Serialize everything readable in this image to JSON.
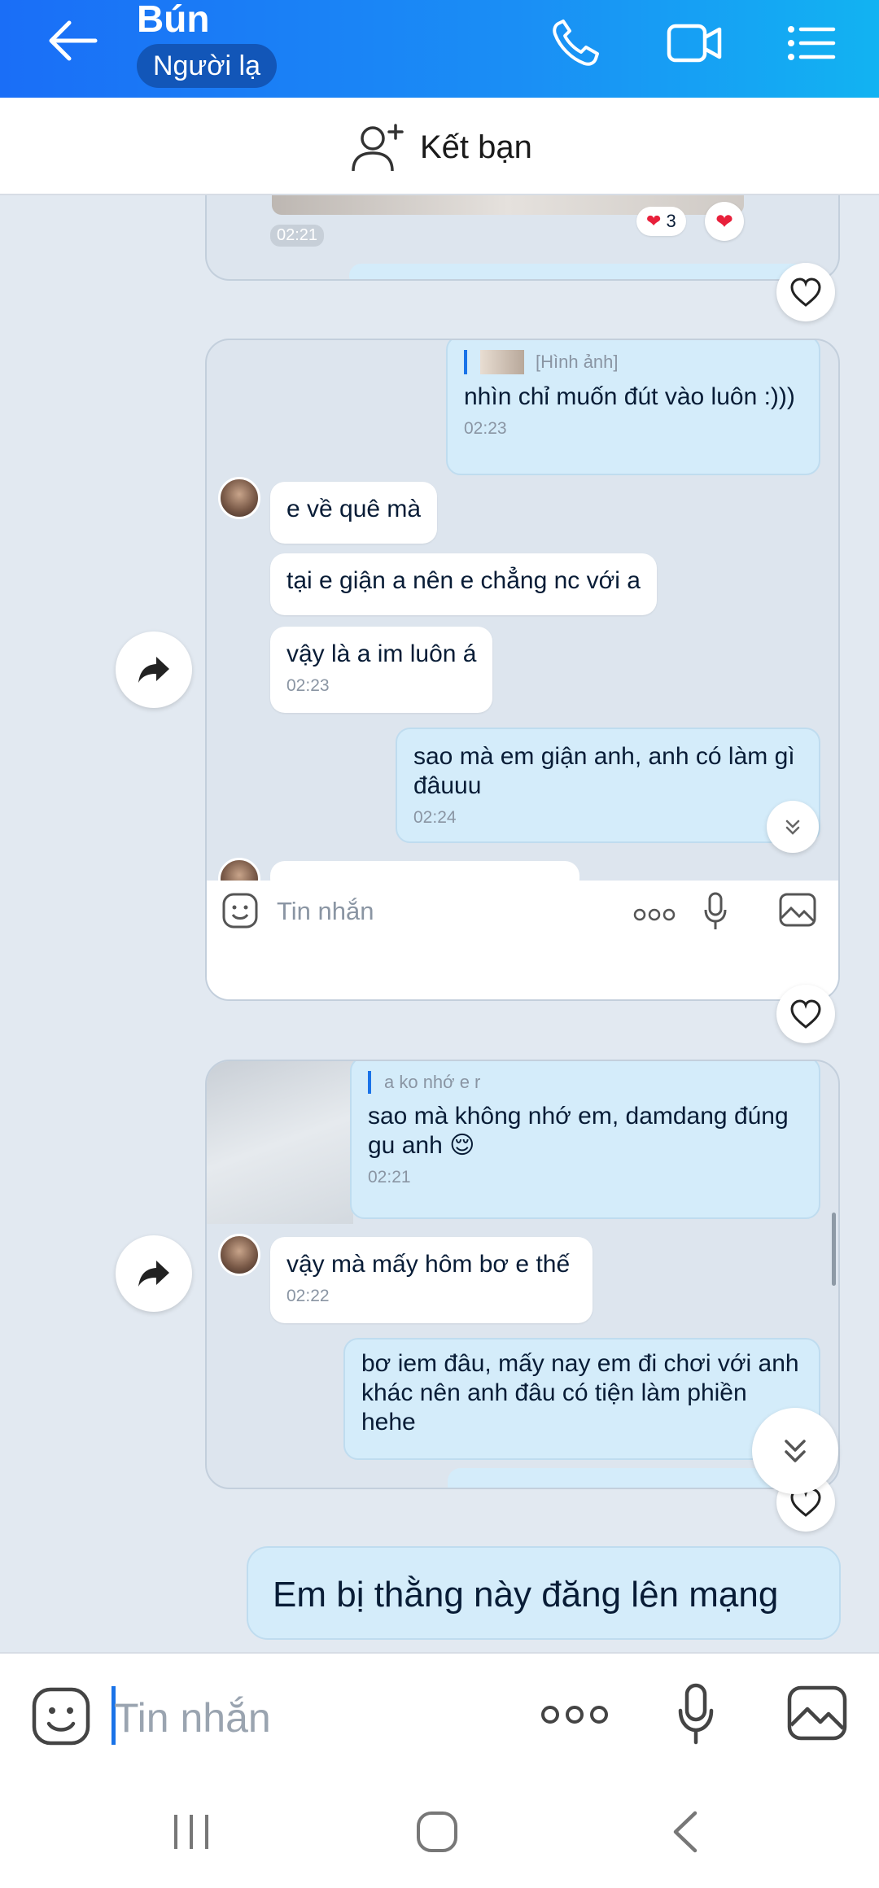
{
  "header": {
    "title": "Bún",
    "badge": "Người lạ",
    "back_icon": "back-arrow-icon",
    "call_icon": "phone-icon",
    "video_icon": "video-camera-icon",
    "menu_icon": "list-menu-icon"
  },
  "friendbar": {
    "label": "Kết bạn",
    "icon": "add-friend-icon"
  },
  "card1": {
    "time": "02:21",
    "reaction_count": "3"
  },
  "card2": {
    "quote": "[Hình ảnh]",
    "out1": {
      "text": "nhìn chỉ muốn đút vào luôn :)))",
      "time": "02:23"
    },
    "in1": {
      "text": "e về quê mà"
    },
    "in2": {
      "text": "tại e giận a nên e chẳng nc với a"
    },
    "in3": {
      "text": "vậy là a im luôn á",
      "time": "02:23"
    },
    "out2": {
      "text": "sao mà em giận anh, anh có làm gì đâuuu",
      "time": "02:24"
    },
    "input_placeholder": "Tin nhắn"
  },
  "card3": {
    "quote": "a ko nhớ e r",
    "out1": {
      "text": "sao mà không nhớ em, damdang đúng gu anh 😌",
      "time": "02:21"
    },
    "in1": {
      "text": "vậy mà mấy hôm bơ e thế",
      "time": "02:22"
    },
    "out2": {
      "text": "bơ iem đâu, mấy nay em đi chơi với anh khác nên anh đâu có tiện làm phiền hehe"
    }
  },
  "final_message": "Em bị thằng này đăng lên mạng",
  "input": {
    "placeholder": "Tin nhắn"
  },
  "colors": {
    "header_start": "#1a6ef7",
    "header_end": "#12b3f2",
    "outgoing_bubble": "#d4ecfa",
    "background": "#e2e9f1"
  }
}
